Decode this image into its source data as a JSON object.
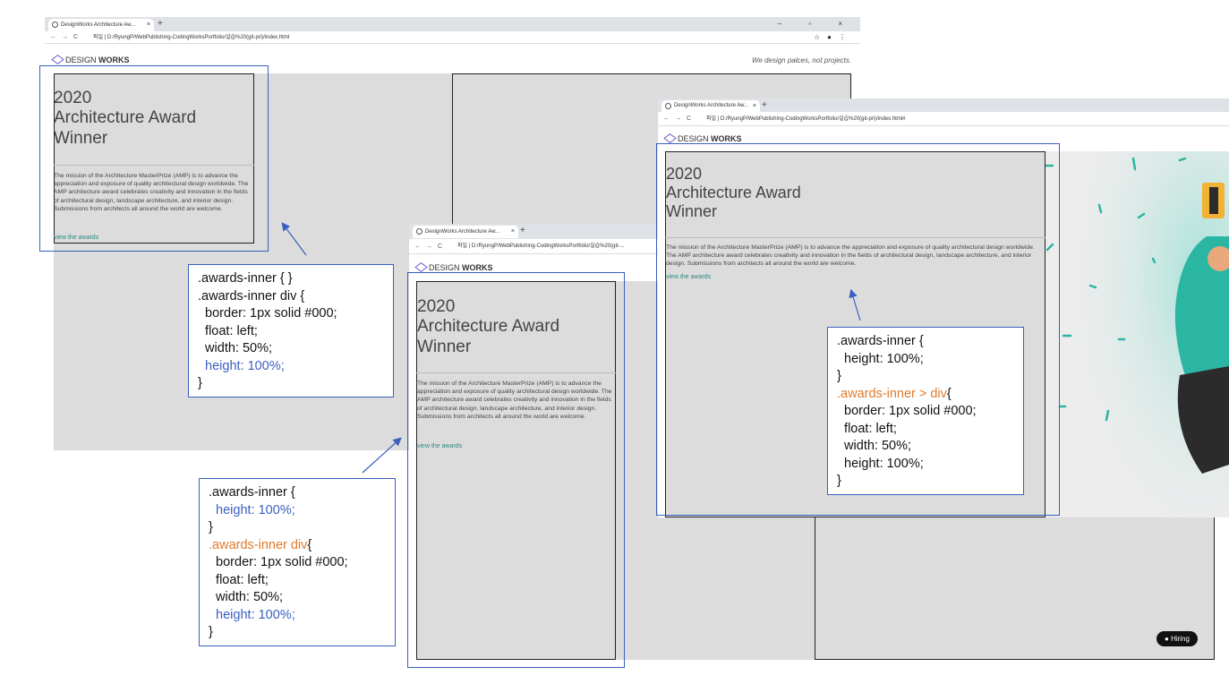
{
  "windows": [
    {
      "tab_title": "DesignWorks Architecture Aw...",
      "url": "파일 | D:/RyungP/WebPublishing-CodingWorksPortfolio/실습%20(git-pri)/index.html",
      "window_controls": "– ▫ ×"
    },
    {
      "tab_title": "DesignWorks Architecture Aw...",
      "url": "파일 | D:/RyungP/WebPublishing-CodingWorksPortfolio/실습%20(git-..."
    },
    {
      "tab_title": "DesignWorks Architecture Aw...",
      "url": "파일 | D:/RyungP/WebPublishing-CodingWorksPortfolio/실습%20(git-pri)/index.html#"
    }
  ],
  "nav": {
    "back": "←",
    "forward": "→",
    "reload": "C",
    "info": "ⓘ",
    "star": "☆",
    "profile": "●",
    "menu": "⋮",
    "newtab": "+",
    "tab_close": "×"
  },
  "site": {
    "logo_light": "DESIGN",
    "logo_bold": "WORKS",
    "tagline": "We design palces, not projects.",
    "heading_year": "2020",
    "heading_line2": "Architecture Award",
    "heading_line3": "Winner",
    "mission": "The mission of the Architecture MasterPrize (AMP) is to advance the appreciation and exposure of quality architectural design worldwide. The AMP architecture award celebrates creativity and innovation in the fields of architectural design, landscape architecture, and interior design. Submissions from architects all around the world are welcome.",
    "view_link": "view the awards",
    "hiring_label": "Hiring"
  },
  "code_boxes": [
    {
      "lines": [
        {
          "text": ".awards-inner { }",
          "color": "default"
        },
        {
          "text": ".awards-inner div {",
          "color": "default"
        },
        {
          "text": "  border: 1px solid #000;",
          "color": "default"
        },
        {
          "text": "  float: left;",
          "color": "default"
        },
        {
          "text": "  width: 50%;",
          "color": "default"
        },
        {
          "text": "  height: 100%;",
          "color": "blue"
        },
        {
          "text": "}",
          "color": "default"
        }
      ]
    },
    {
      "lines": [
        {
          "text": ".awards-inner {",
          "color": "default"
        },
        {
          "text": "  height: 100%;",
          "color": "blue"
        },
        {
          "text": "}",
          "color": "default"
        },
        {
          "text": ".awards-inner div",
          "color": "orange",
          "suffix": "{"
        },
        {
          "text": "  border: 1px solid #000;",
          "color": "default"
        },
        {
          "text": "  float: left;",
          "color": "default"
        },
        {
          "text": "  width: 50%;",
          "color": "default"
        },
        {
          "text": "  height: 100%;",
          "color": "blue"
        },
        {
          "text": "}",
          "color": "default"
        }
      ]
    },
    {
      "lines": [
        {
          "text": ".awards-inner {",
          "color": "default"
        },
        {
          "text": "  height: 100%;",
          "color": "default"
        },
        {
          "text": "}",
          "color": "default"
        },
        {
          "text": ".awards-inner > div",
          "color": "orange",
          "suffix": "{"
        },
        {
          "text": "  border: 1px solid #000;",
          "color": "default"
        },
        {
          "text": "  float: left;",
          "color": "default"
        },
        {
          "text": "  width: 50%;",
          "color": "default"
        },
        {
          "text": "  height: 100%;",
          "color": "default"
        },
        {
          "text": "}",
          "color": "default"
        }
      ]
    }
  ],
  "colors": {
    "annotation_blue": "#3a5fc0",
    "selector_orange": "#e07a2a",
    "content_grey": "#dcdcdc",
    "link_teal": "#2a8a80"
  }
}
